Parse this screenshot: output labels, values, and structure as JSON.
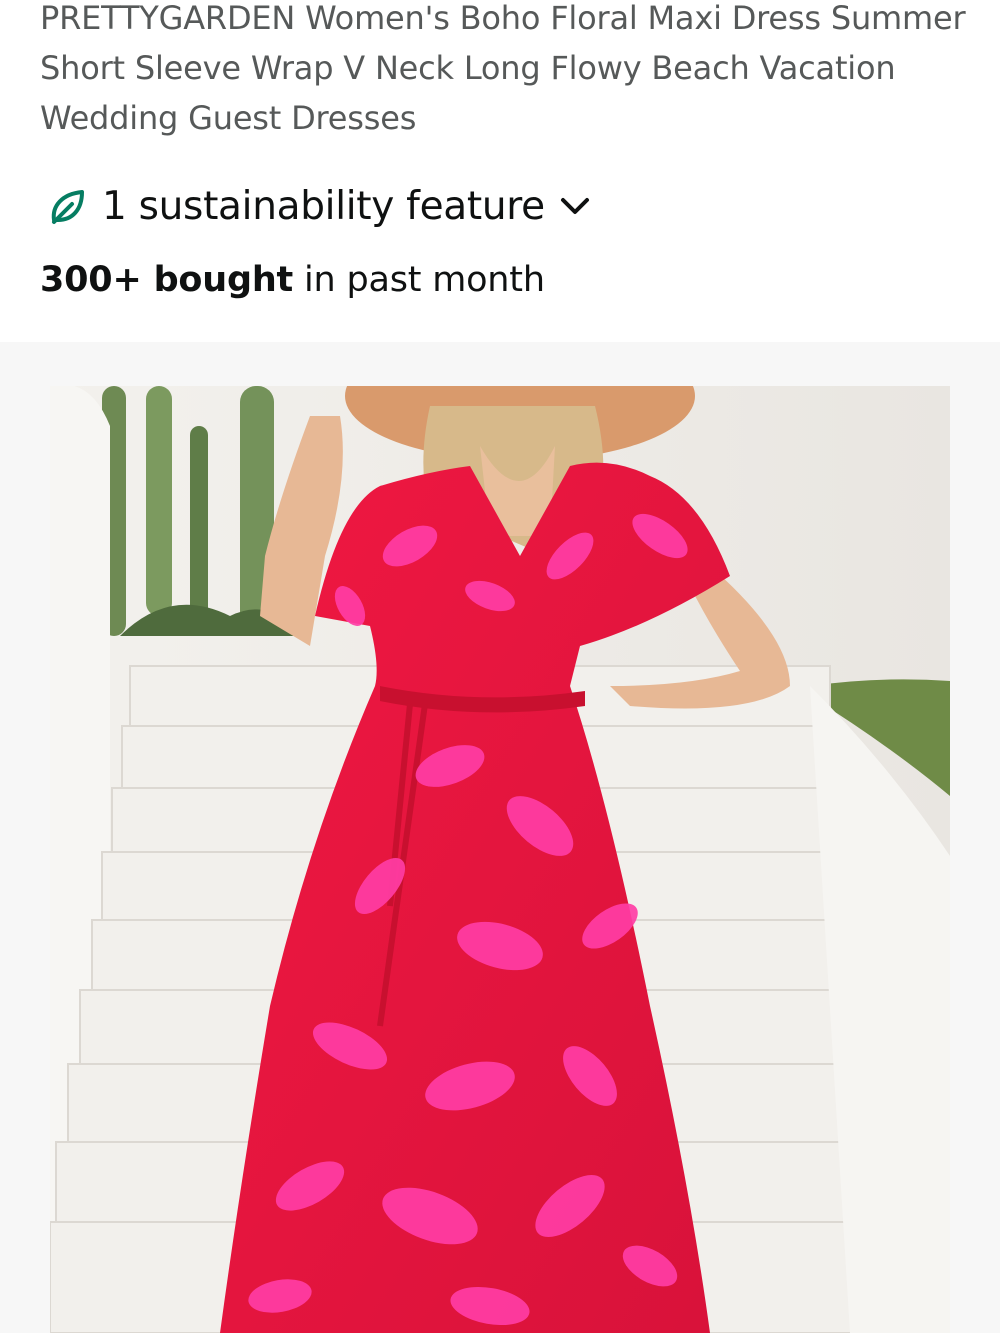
{
  "product": {
    "title": "PRETTYGARDEN Women's Boho Floral Maxi Dress Summer Short Sleeve Wrap V Neck Long Flowy Beach Vacation Wedding Guest Dresses",
    "sustainability": {
      "label": "1 sustainability feature",
      "icon": "leaf-icon",
      "expand_icon": "chevron-down-icon",
      "accent_color": "#067d62"
    },
    "social_proof": {
      "count": "300+ bought",
      "suffix": " in past month"
    },
    "image": {
      "alt": "Woman wearing a red and pink floral wrap maxi dress with a wide-brim straw hat on white stairs",
      "dress_color": "#e3173f",
      "print_color": "#ff3ea5"
    }
  }
}
